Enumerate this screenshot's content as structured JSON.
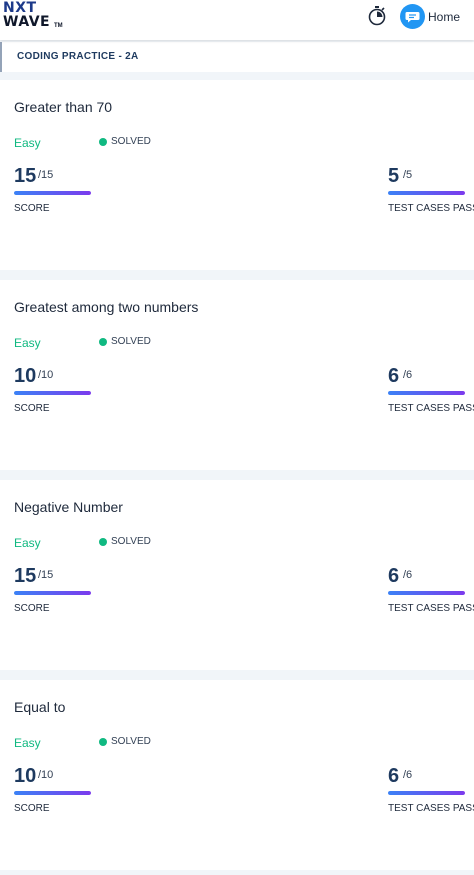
{
  "header": {
    "logo_line1": "NXT",
    "logo_line2": "WAVE",
    "logo_tm": "TM",
    "timer_icon": "stopwatch-icon",
    "home_icon": "chat-bubble-icon",
    "home_label": "Home"
  },
  "section": {
    "title": "CODING PRACTICE - 2A"
  },
  "colors": {
    "accent_green": "#10b981",
    "primary_text": "#1e3a5f",
    "progress_start": "#3b82f6",
    "progress_end": "#7c3aed"
  },
  "questions": [
    {
      "title": "Greater than 70",
      "difficulty": "Easy",
      "status": "SOLVED",
      "score": "15",
      "score_total": "/15",
      "score_label": "SCORE",
      "score_progress": 1.0,
      "tests": "5",
      "tests_total": "/5",
      "tests_label": "TEST CASES PASSE",
      "tests_progress": 1.0
    },
    {
      "title": "Greatest among two numbers",
      "difficulty": "Easy",
      "status": "SOLVED",
      "score": "10",
      "score_total": "/10",
      "score_label": "SCORE",
      "score_progress": 1.0,
      "tests": "6",
      "tests_total": "/6",
      "tests_label": "TEST CASES PASSE",
      "tests_progress": 1.0
    },
    {
      "title": "Negative Number",
      "difficulty": "Easy",
      "status": "SOLVED",
      "score": "15",
      "score_total": "/15",
      "score_label": "SCORE",
      "score_progress": 1.0,
      "tests": "6",
      "tests_total": "/6",
      "tests_label": "TEST CASES PASSE",
      "tests_progress": 1.0
    },
    {
      "title": "Equal to",
      "difficulty": "Easy",
      "status": "SOLVED",
      "score": "10",
      "score_total": "/10",
      "score_label": "SCORE",
      "score_progress": 1.0,
      "tests": "6",
      "tests_total": "/6",
      "tests_label": "TEST CASES PASSE",
      "tests_progress": 1.0
    }
  ]
}
